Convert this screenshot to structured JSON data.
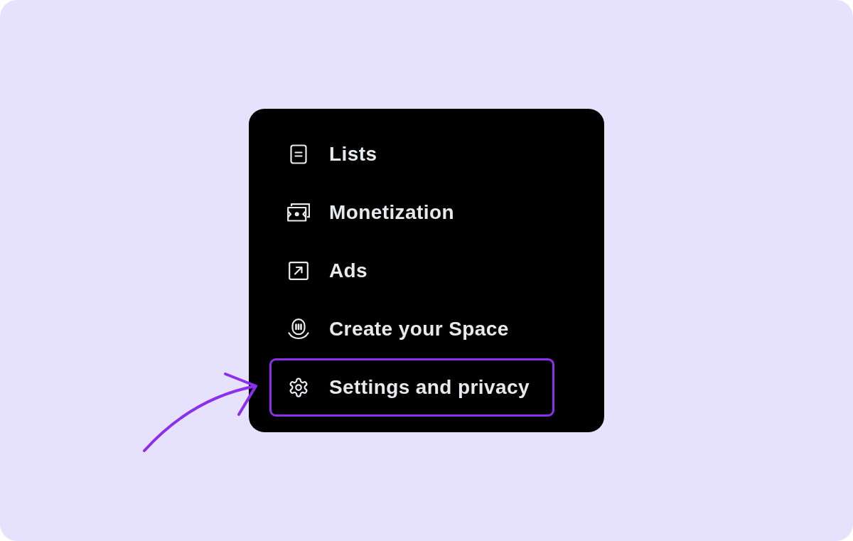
{
  "menu": {
    "items": [
      {
        "label": "Lists",
        "selected": false
      },
      {
        "label": "Monetization",
        "selected": false
      },
      {
        "label": "Ads",
        "selected": false
      },
      {
        "label": "Create your Space",
        "selected": false
      },
      {
        "label": "Settings and privacy",
        "selected": true
      }
    ]
  }
}
